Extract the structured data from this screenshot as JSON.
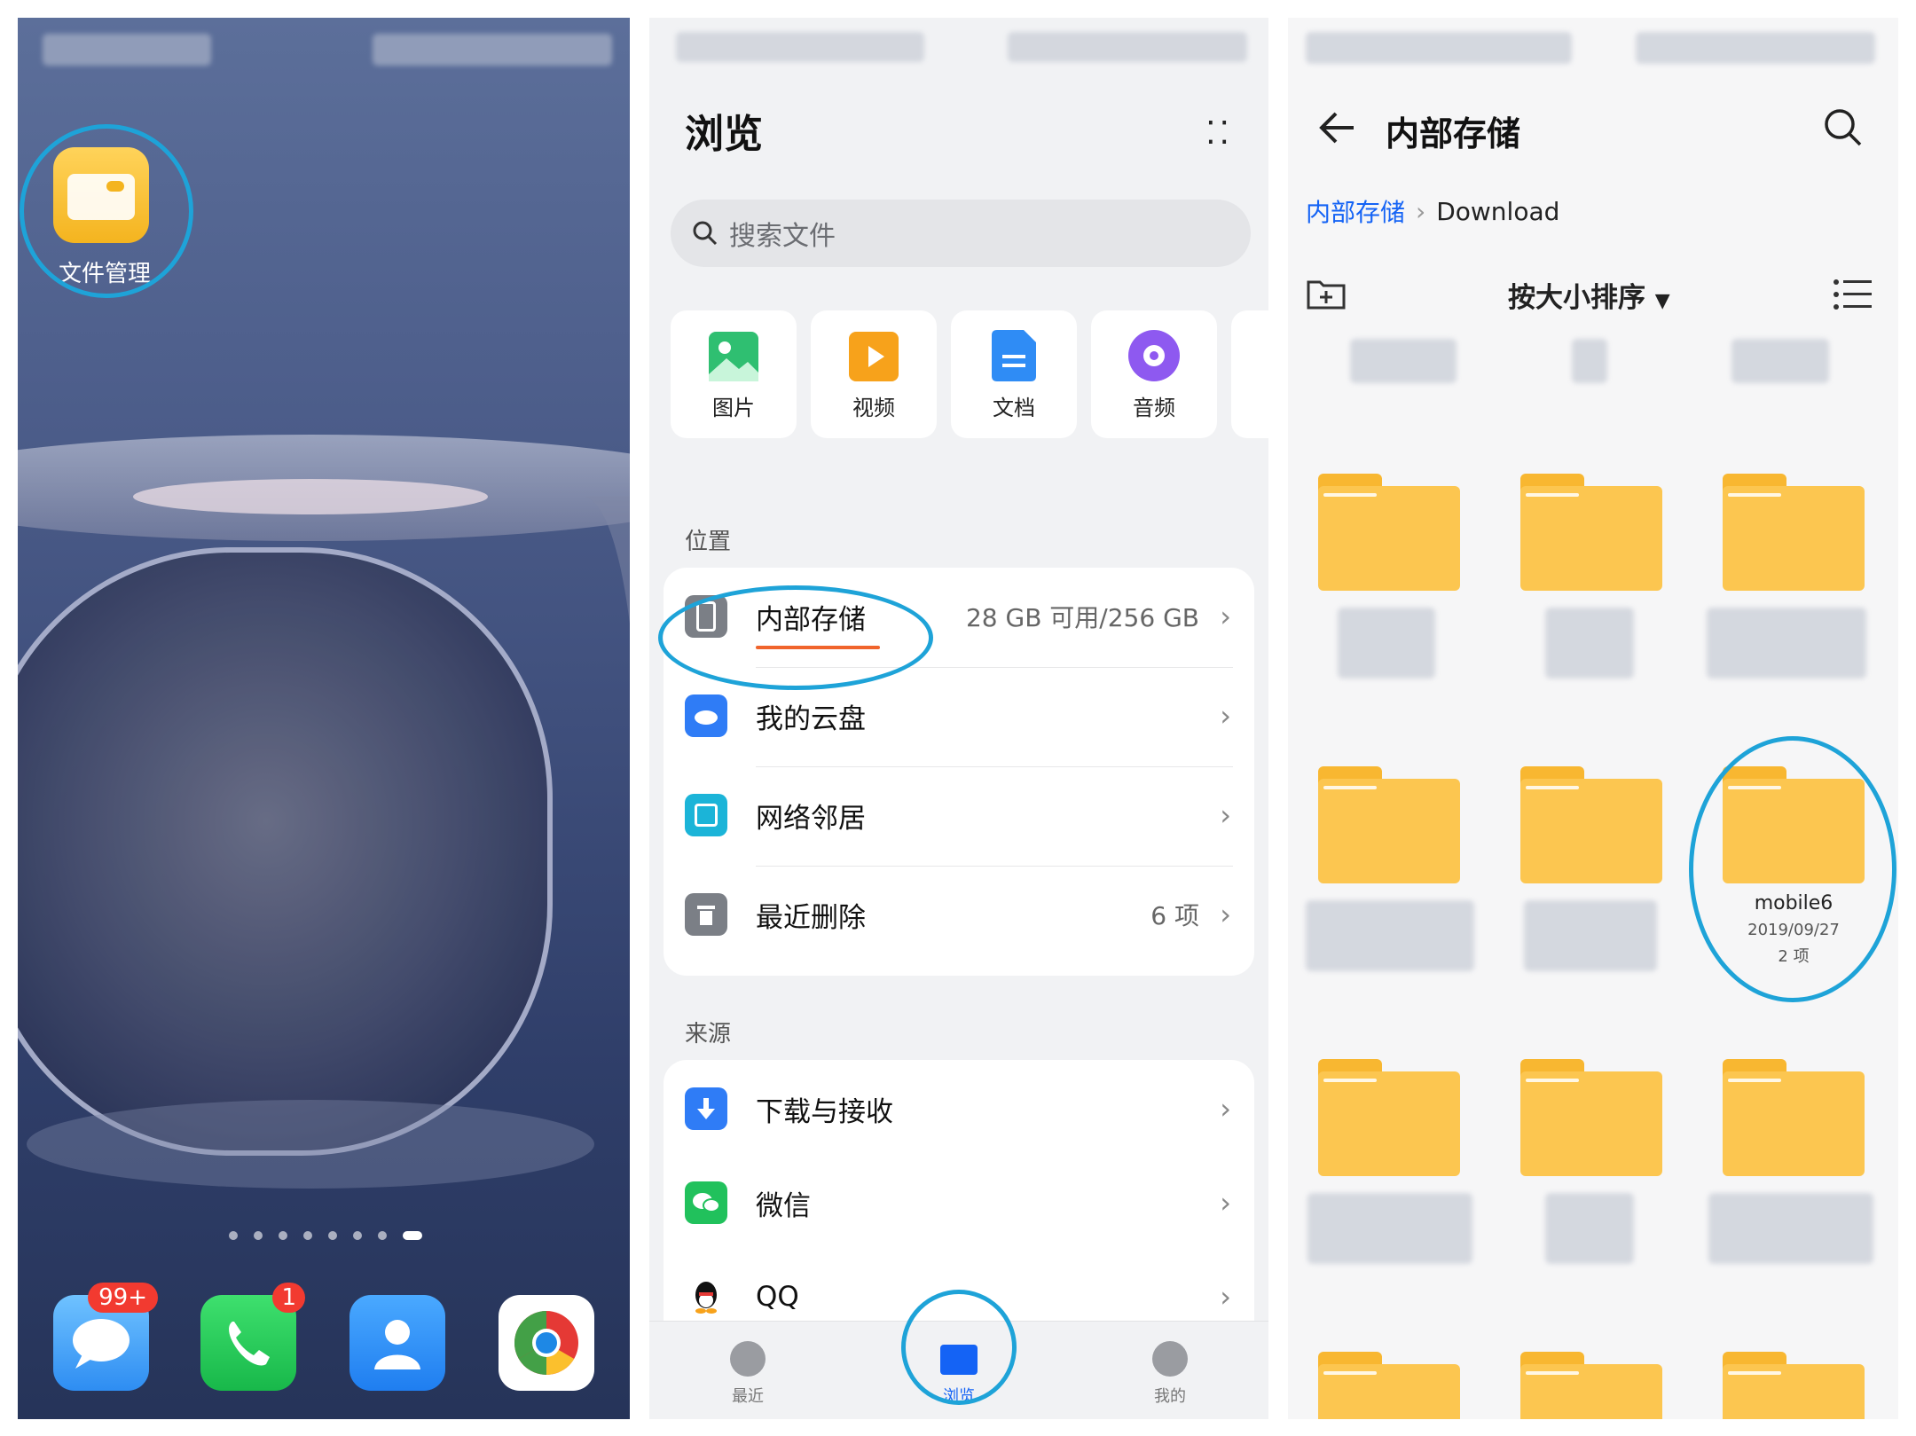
{
  "home": {
    "file_manager_label": "文件管理",
    "messages_badge": "99+",
    "phone_badge": "1"
  },
  "browse": {
    "title": "浏览",
    "more_icon": "more-dots-icon",
    "search_placeholder": "搜索文件",
    "categories": [
      {
        "label": "图片",
        "icon": "image-icon",
        "color": "#2fbf71"
      },
      {
        "label": "视频",
        "icon": "video-icon",
        "color": "#f7a21b"
      },
      {
        "label": "文档",
        "icon": "document-icon",
        "color": "#2f8cf5"
      },
      {
        "label": "音频",
        "icon": "audio-icon",
        "color": "#8e59f0"
      }
    ],
    "location_label": "位置",
    "locations": [
      {
        "label": "内部存储",
        "value": "28 GB 可用/256 GB",
        "icon": "phone-storage-icon",
        "color": "#7b7f86"
      },
      {
        "label": "我的云盘",
        "value": "",
        "icon": "cloud-icon",
        "color": "#2f7cf6"
      },
      {
        "label": "网络邻居",
        "value": "",
        "icon": "network-icon",
        "color": "#1bb4d8"
      },
      {
        "label": "最近删除",
        "value": "6 项",
        "icon": "trash-icon",
        "color": "#7b7f86"
      }
    ],
    "source_label": "来源",
    "sources": [
      {
        "label": "下载与接收",
        "icon": "download-icon",
        "color": "#2f7cf6"
      },
      {
        "label": "微信",
        "icon": "wechat-icon",
        "color": "#21c15c"
      },
      {
        "label": "QQ",
        "icon": "qq-icon",
        "color": "#111111"
      }
    ],
    "nav": [
      {
        "label": "最近",
        "icon": "clock-icon"
      },
      {
        "label": "浏览",
        "icon": "folder-icon"
      },
      {
        "label": "我的",
        "icon": "person-icon"
      }
    ],
    "accent": "#1463f5",
    "highlight_ring": "#1ea3d8"
  },
  "storage": {
    "title": "内部存储",
    "breadcrumb_root": "内部存储",
    "breadcrumb_current": "Download",
    "sort_label": "按大小排序",
    "highlighted_folder": {
      "name": "mobile6",
      "date": "2019/09/27",
      "count": "2 项"
    }
  }
}
